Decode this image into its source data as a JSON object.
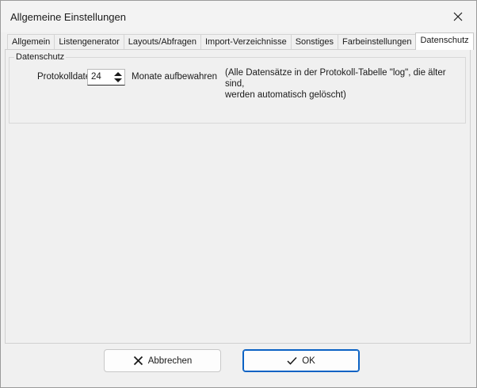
{
  "window": {
    "title": "Allgemeine Einstellungen"
  },
  "tabs": [
    {
      "label": "Allgemein",
      "active": false
    },
    {
      "label": "Listengenerator",
      "active": false
    },
    {
      "label": "Layouts/Abfragen",
      "active": false
    },
    {
      "label": "Import-Verzeichnisse",
      "active": false
    },
    {
      "label": "Sonstiges",
      "active": false
    },
    {
      "label": "Farbeinstellungen",
      "active": false
    },
    {
      "label": "Datenschutz",
      "active": true
    }
  ],
  "datenschutz": {
    "group_title": "Datenschutz",
    "protokoll_label": "Protokolldaten",
    "protokoll_value": "24",
    "monate_label": "Monate aufbewahren",
    "note_line1": "(Alle Datensätze in der Protokoll-Tabelle \"log\", die älter sind,",
    "note_line2": "werden automatisch gelöscht)"
  },
  "buttons": {
    "cancel_label": "Abbrechen",
    "ok_label": "OK"
  },
  "icons": [
    "close-icon",
    "spin-up-icon",
    "spin-down-icon",
    "cancel-x-icon",
    "check-icon"
  ]
}
